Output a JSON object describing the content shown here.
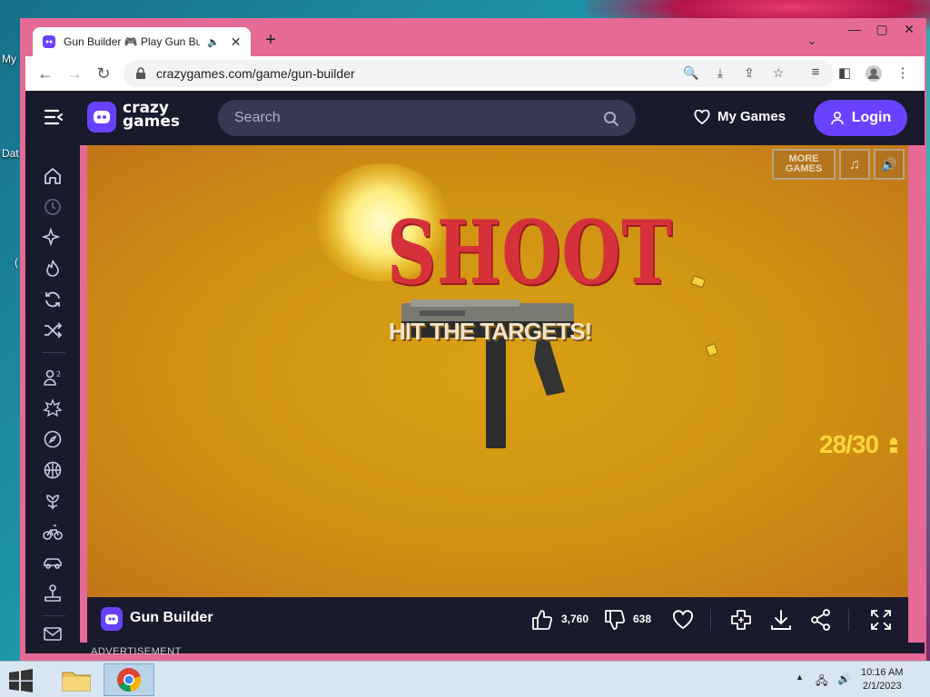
{
  "desktop": {
    "labels": [
      "My",
      "Dat",
      "("
    ]
  },
  "browser": {
    "tab_title": "Gun Builder 🎮 Play Gun Builder on CrazyGames",
    "url": "crazygames.com/game/gun-builder"
  },
  "site": {
    "logo_line1": "crazy",
    "logo_line2": "games",
    "search_placeholder": "Search",
    "my_games": "My Games",
    "login": "Login"
  },
  "game": {
    "more_games": "MORE GAMES",
    "headline": "SHOOT",
    "subheadline": "HIT THE TARGETS!",
    "ammo": "28/30"
  },
  "game_bar": {
    "title": "Gun Builder",
    "likes": "3,760",
    "dislikes": "638"
  },
  "advertisement": "ADVERTISEMENT",
  "taskbar": {
    "time": "10:16 AM",
    "date": "2/1/2023"
  },
  "colors": {
    "brand": "#6842ff",
    "header_bg": "#191a2b",
    "game_bg": "#cf9214",
    "frame": "#e56a96"
  }
}
